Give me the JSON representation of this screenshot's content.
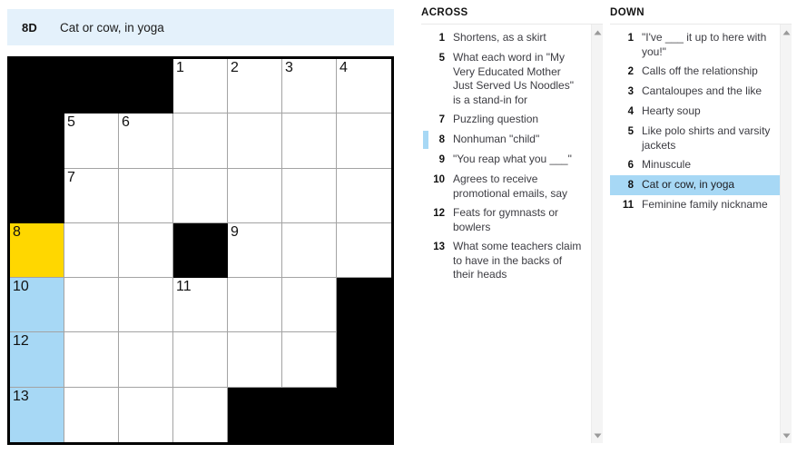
{
  "current_clue": {
    "label": "8D",
    "text": "Cat or cow, in yoga"
  },
  "colors": {
    "cursor_cell": "#ffd700",
    "word_highlight": "#a7d8f5",
    "clue_bar_background": "#e4f1fb",
    "block_cell": "#000000",
    "grid_line": "#a3a3a3"
  },
  "grid": {
    "rows": 7,
    "cols": 7,
    "cells": [
      [
        {
          "block": true
        },
        {
          "block": true
        },
        {
          "block": true
        },
        {
          "number": "1",
          "letter": ""
        },
        {
          "number": "2",
          "letter": ""
        },
        {
          "number": "3",
          "letter": ""
        },
        {
          "number": "4",
          "letter": ""
        }
      ],
      [
        {
          "block": true
        },
        {
          "number": "5",
          "letter": ""
        },
        {
          "number": "6",
          "letter": ""
        },
        {
          "number": "",
          "letter": ""
        },
        {
          "number": "",
          "letter": ""
        },
        {
          "number": "",
          "letter": ""
        },
        {
          "number": "",
          "letter": ""
        }
      ],
      [
        {
          "block": true
        },
        {
          "number": "7",
          "letter": ""
        },
        {
          "number": "",
          "letter": ""
        },
        {
          "number": "",
          "letter": ""
        },
        {
          "number": "",
          "letter": ""
        },
        {
          "number": "",
          "letter": ""
        },
        {
          "number": "",
          "letter": ""
        }
      ],
      [
        {
          "number": "8",
          "letter": "",
          "highlight": "cursor"
        },
        {
          "number": "",
          "letter": ""
        },
        {
          "number": "",
          "letter": ""
        },
        {
          "block": true
        },
        {
          "number": "9",
          "letter": ""
        },
        {
          "number": "",
          "letter": ""
        },
        {
          "number": "",
          "letter": ""
        }
      ],
      [
        {
          "number": "10",
          "letter": "",
          "highlight": "word"
        },
        {
          "number": "",
          "letter": ""
        },
        {
          "number": "",
          "letter": ""
        },
        {
          "number": "11",
          "letter": ""
        },
        {
          "number": "",
          "letter": ""
        },
        {
          "number": "",
          "letter": ""
        },
        {
          "block": true
        }
      ],
      [
        {
          "number": "12",
          "letter": "",
          "highlight": "word"
        },
        {
          "number": "",
          "letter": ""
        },
        {
          "number": "",
          "letter": ""
        },
        {
          "number": "",
          "letter": ""
        },
        {
          "number": "",
          "letter": ""
        },
        {
          "number": "",
          "letter": ""
        },
        {
          "block": true
        }
      ],
      [
        {
          "number": "13",
          "letter": "",
          "highlight": "word"
        },
        {
          "number": "",
          "letter": ""
        },
        {
          "number": "",
          "letter": ""
        },
        {
          "number": "",
          "letter": ""
        },
        {
          "block": true
        },
        {
          "block": true
        },
        {
          "block": true
        }
      ]
    ]
  },
  "across": {
    "title": "ACROSS",
    "clues": [
      {
        "number": "1",
        "text": "Shortens, as a skirt",
        "state": "normal"
      },
      {
        "number": "5",
        "text": "What each word in \"My Very Educated Mother Just Served Us Noodles\" is a stand-in for",
        "state": "normal"
      },
      {
        "number": "7",
        "text": "Puzzling question",
        "state": "normal"
      },
      {
        "number": "8",
        "text": "Nonhuman \"child\"",
        "state": "marker"
      },
      {
        "number": "9",
        "text": "\"You reap what you ___\"",
        "state": "normal"
      },
      {
        "number": "10",
        "text": "Agrees to receive promotional emails, say",
        "state": "normal"
      },
      {
        "number": "12",
        "text": "Feats for gymnasts or bowlers",
        "state": "normal"
      },
      {
        "number": "13",
        "text": "What some teachers claim to have in the backs of their heads",
        "state": "normal"
      }
    ]
  },
  "down": {
    "title": "DOWN",
    "clues": [
      {
        "number": "1",
        "text": "\"I've ___ it up to here with you!\"",
        "state": "normal"
      },
      {
        "number": "2",
        "text": "Calls off the relationship",
        "state": "normal"
      },
      {
        "number": "3",
        "text": "Cantaloupes and the like",
        "state": "normal"
      },
      {
        "number": "4",
        "text": "Hearty soup",
        "state": "normal"
      },
      {
        "number": "5",
        "text": "Like polo shirts and varsity jackets",
        "state": "normal"
      },
      {
        "number": "6",
        "text": "Minuscule",
        "state": "normal"
      },
      {
        "number": "8",
        "text": "Cat or cow, in yoga",
        "state": "selected"
      },
      {
        "number": "11",
        "text": "Feminine family nickname",
        "state": "normal"
      }
    ]
  },
  "scrollbars": {
    "across": {
      "up_arrow": "triangle-up-icon",
      "down_arrow": "triangle-down-icon"
    },
    "down": {
      "up_arrow": "triangle-up-icon",
      "down_arrow": "triangle-down-icon"
    }
  }
}
